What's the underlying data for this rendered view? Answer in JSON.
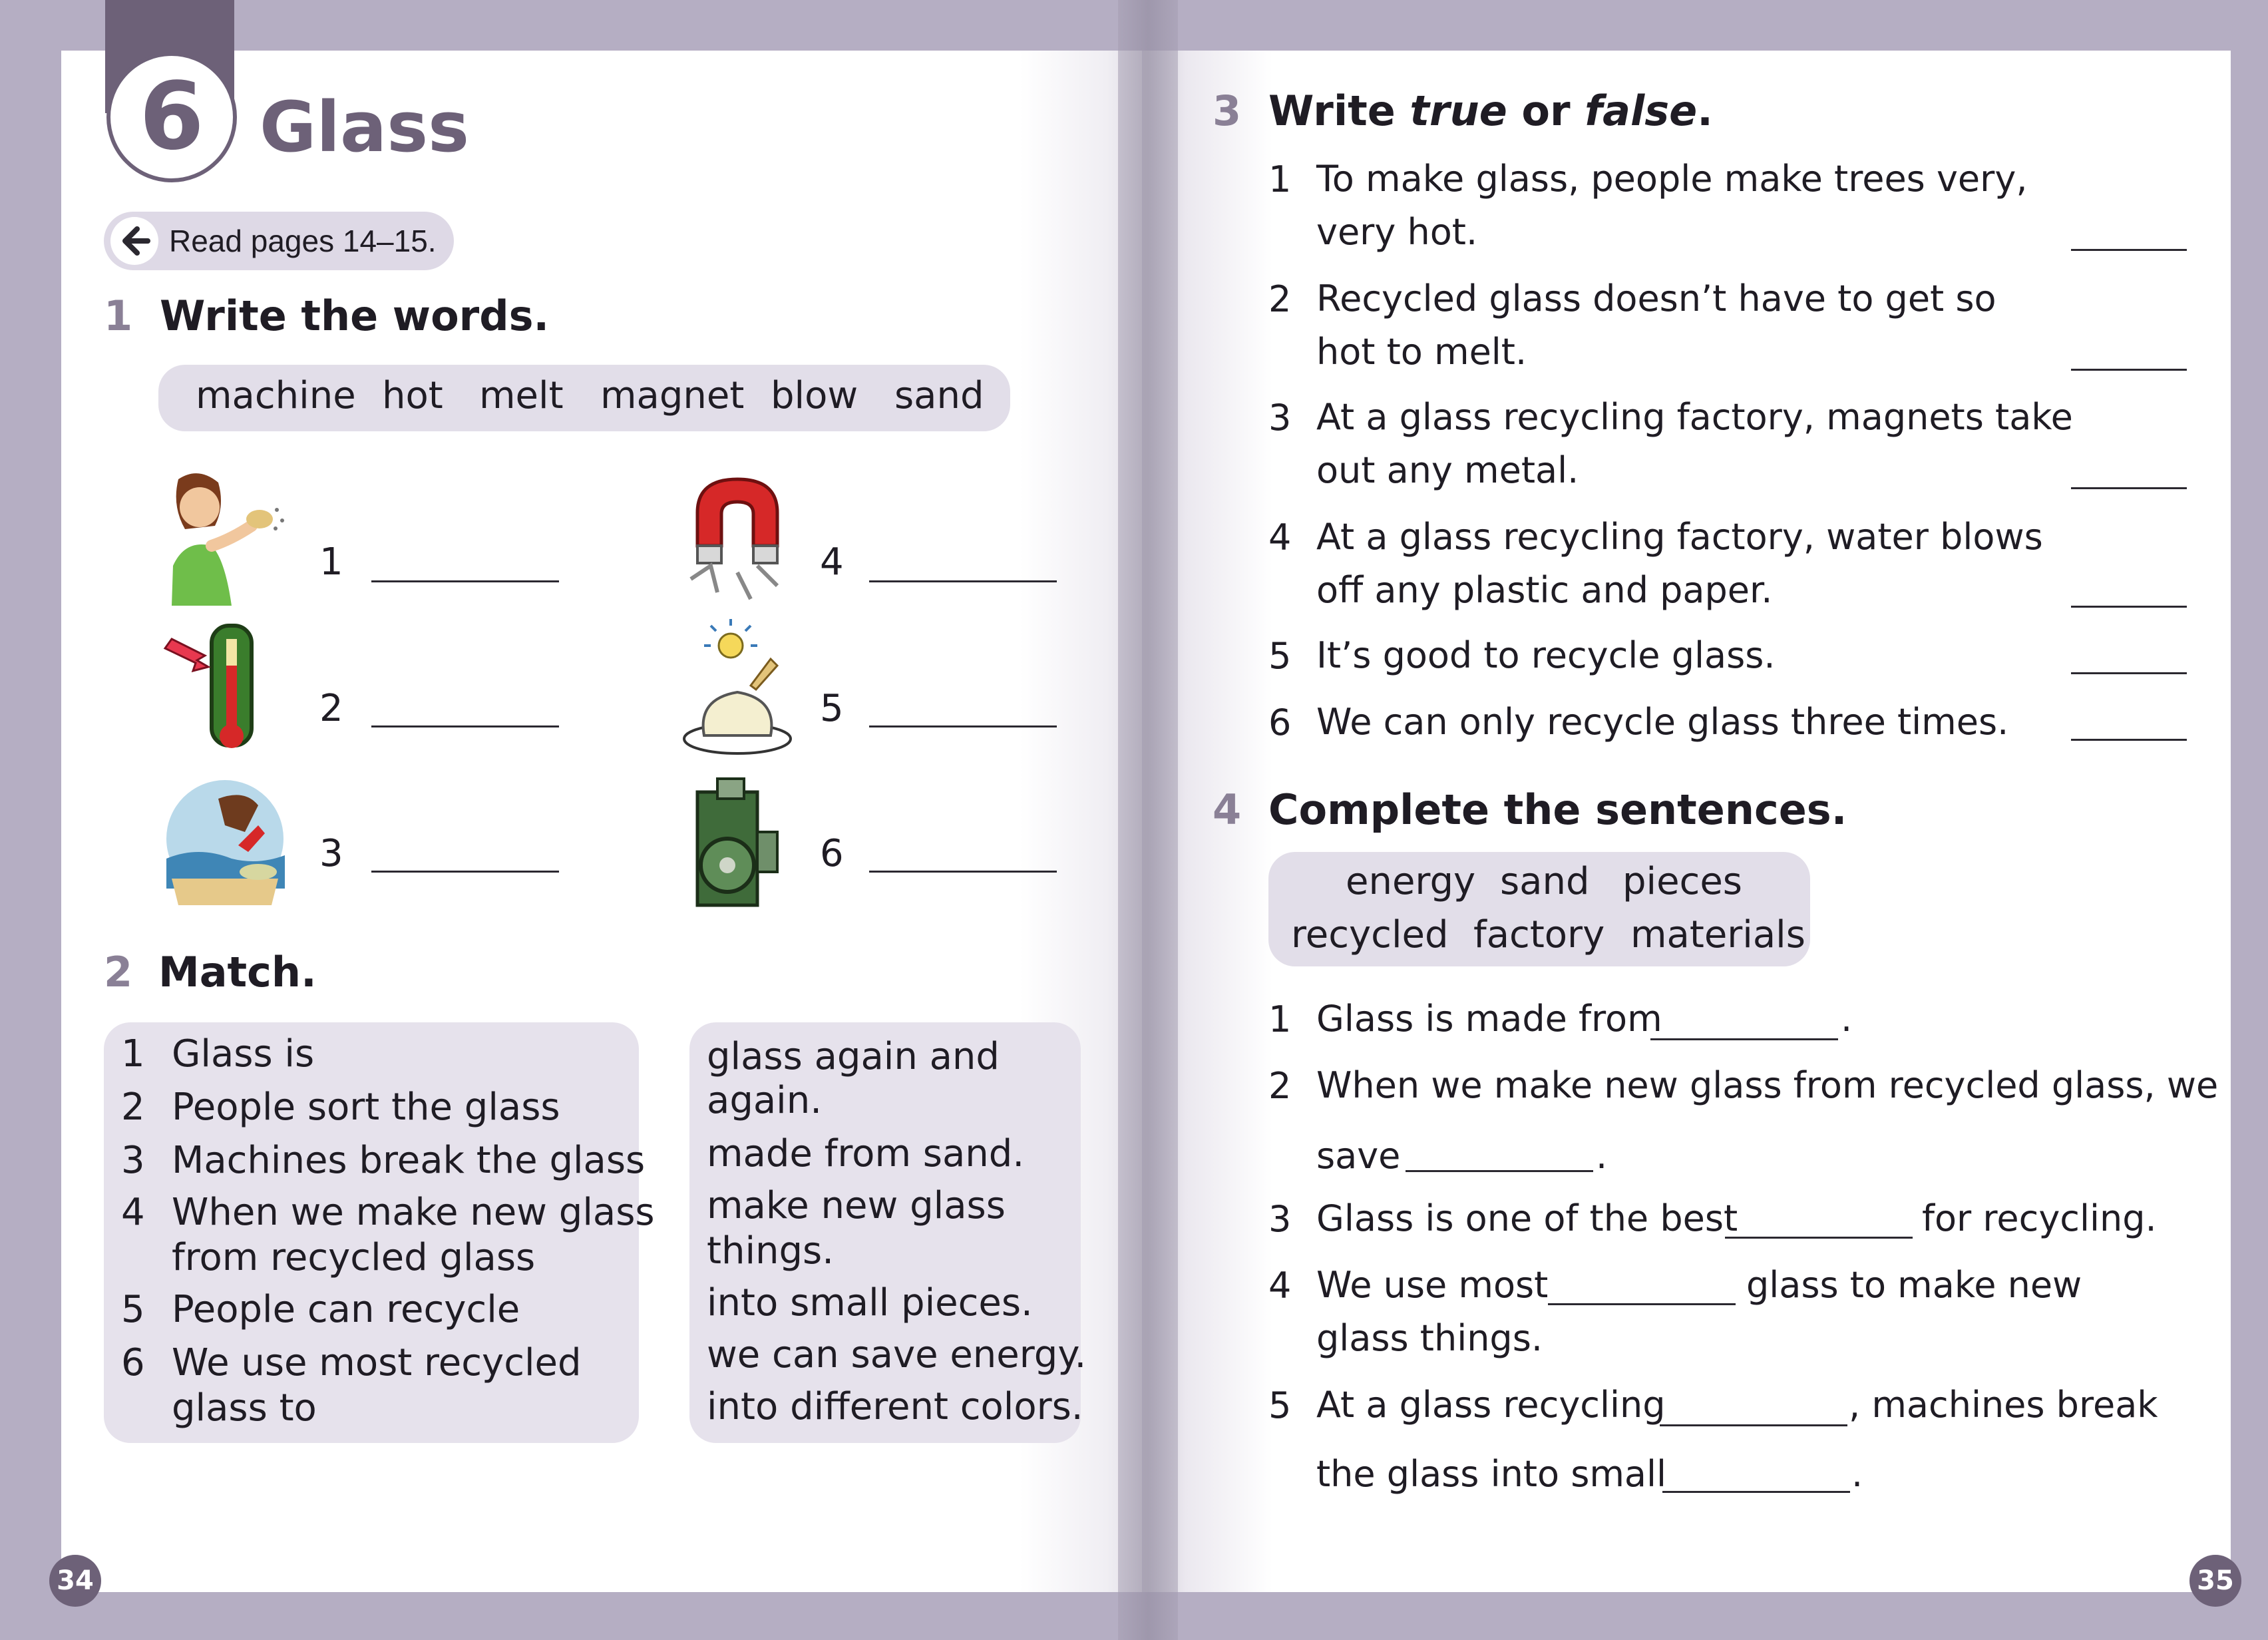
{
  "chapter": {
    "number": "6",
    "title": "Glass"
  },
  "read_pages": "Read pages 14–15.",
  "ex1": {
    "number": "1",
    "title": "Write the words.",
    "words": [
      "machine",
      "hot",
      "melt",
      "magnet",
      "blow",
      "sand"
    ],
    "items": [
      "1",
      "2",
      "3",
      "4",
      "5",
      "6"
    ]
  },
  "ex2": {
    "number": "2",
    "title": "Match.",
    "left_numbers": [
      "1",
      "2",
      "3",
      "4",
      "5",
      "6"
    ],
    "left_lines": [
      "Glass is",
      "People sort the glass",
      "Machines break the glass",
      "When we make new glass",
      "from recycled glass",
      "People can recycle",
      "We use most recycled",
      "glass to"
    ],
    "right_lines": [
      "glass again and",
      "again.",
      "made from sand.",
      "make new glass",
      "things.",
      "into small pieces.",
      "we can save energy.",
      "into different colors."
    ]
  },
  "ex3": {
    "number": "3",
    "title_parts": [
      "Write ",
      "true",
      " or ",
      "false",
      "."
    ],
    "numbers": [
      "1",
      "2",
      "3",
      "4",
      "5",
      "6"
    ],
    "lines": [
      "To make glass, people make trees very,",
      "very hot.",
      "Recycled glass doesn’t have to get so",
      "hot to melt.",
      "At a glass recycling factory, magnets take",
      "out any metal.",
      "At a glass recycling factory, water blows",
      "off any plastic and paper.",
      "It’s good to recycle glass.",
      "We can only recycle glass three times."
    ]
  },
  "ex4": {
    "number": "4",
    "title": "Complete the sentences.",
    "words_row1": [
      "energy",
      "sand",
      "pieces"
    ],
    "words_row2": [
      "recycled",
      "factory",
      "materials"
    ],
    "numbers": [
      "1",
      "2",
      "3",
      "4",
      "5"
    ],
    "s1": [
      "Glass is made from",
      "."
    ],
    "s2": [
      "When we make new glass from recycled glass, we",
      "save",
      "."
    ],
    "s3": [
      "Glass is one of the best",
      "for recycling."
    ],
    "s4": [
      "We use most",
      "glass to make new",
      "glass things."
    ],
    "s5": [
      "At a glass recycling",
      ", machines break",
      "the glass into small",
      "."
    ]
  },
  "page_numbers": {
    "left": "34",
    "right": "35"
  },
  "colors": {
    "accent": "#6d6178",
    "pill": "#e2dee9",
    "heading_number": "#8a8096"
  },
  "icons": [
    "back-arrow-icon",
    "girl-blowing-sand-icon",
    "thermometer-icon",
    "hand-sand-icon",
    "magnet-icon",
    "melting-sun-icon",
    "machine-icon"
  ]
}
